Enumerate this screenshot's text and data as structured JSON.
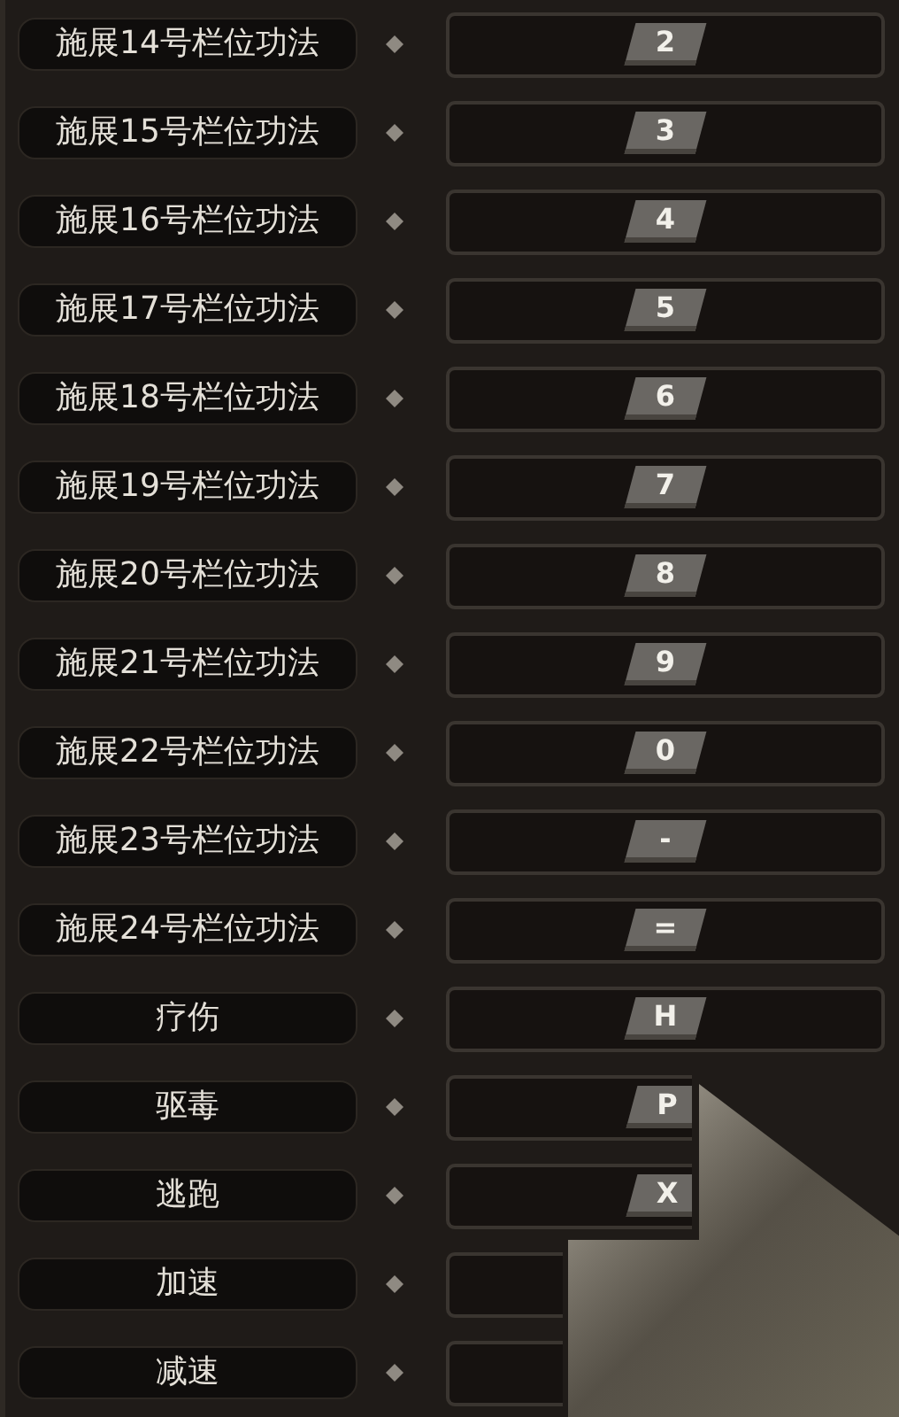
{
  "bindings": [
    {
      "action": "施展14号栏位功法",
      "key": "2",
      "obscured": false
    },
    {
      "action": "施展15号栏位功法",
      "key": "3",
      "obscured": false
    },
    {
      "action": "施展16号栏位功法",
      "key": "4",
      "obscured": false
    },
    {
      "action": "施展17号栏位功法",
      "key": "5",
      "obscured": false
    },
    {
      "action": "施展18号栏位功法",
      "key": "6",
      "obscured": false
    },
    {
      "action": "施展19号栏位功法",
      "key": "7",
      "obscured": false
    },
    {
      "action": "施展20号栏位功法",
      "key": "8",
      "obscured": false
    },
    {
      "action": "施展21号栏位功法",
      "key": "9",
      "obscured": false
    },
    {
      "action": "施展22号栏位功法",
      "key": "0",
      "obscured": false
    },
    {
      "action": "施展23号栏位功法",
      "key": "-",
      "obscured": false
    },
    {
      "action": "施展24号栏位功法",
      "key": "=",
      "obscured": false
    },
    {
      "action": "疗伤",
      "key": "H",
      "obscured": false
    },
    {
      "action": "驱毒",
      "key": "P",
      "obscured": true
    },
    {
      "action": "逃跑",
      "key": "X",
      "obscured": true
    },
    {
      "action": "加速",
      "obscured": true
    },
    {
      "action": "减速",
      "obscured": true
    }
  ]
}
